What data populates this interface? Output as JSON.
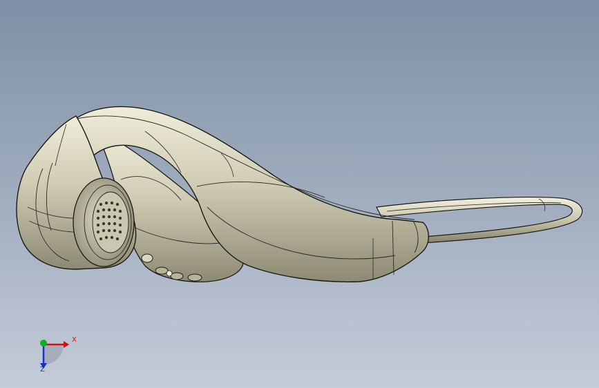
{
  "view": {
    "background_top": "#7f8fa5",
    "background_bottom": "#c4ccd8",
    "model_color": "#c9c6ae"
  },
  "triad": {
    "x_label": "X",
    "z_label": "Z",
    "x_color": "#d01010",
    "y_color": "#10b020",
    "z_color": "#1a2fd0"
  }
}
